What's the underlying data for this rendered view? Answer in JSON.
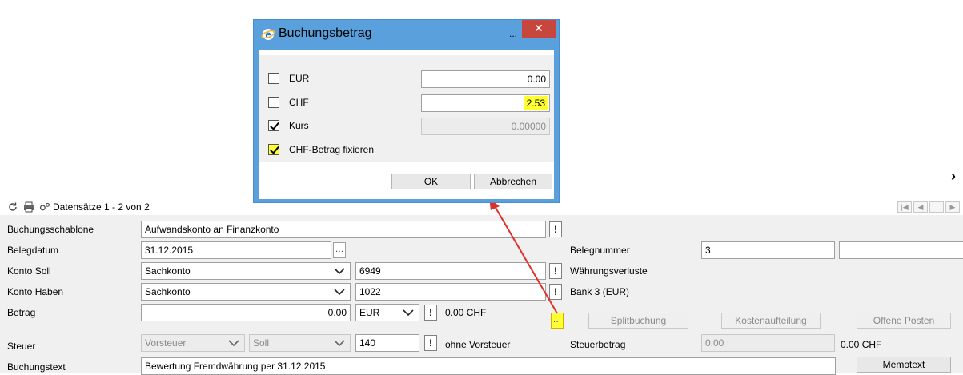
{
  "toolbar": {
    "records_label": "Datensätze 1 - 2 von 2",
    "nav_dots": "..."
  },
  "form": {
    "buchungsschablone": {
      "label": "Buchungsschablone",
      "label_underline": "g",
      "value": "Aufwandskonto an Finanzkonto"
    },
    "belegdatum": {
      "label": "Belegdatum",
      "value": "31.12.2015"
    },
    "belegnummer": {
      "label": "Belegnummer",
      "value": "3",
      "value2": ""
    },
    "konto_soll": {
      "label": "Konto Soll",
      "type": "Sachkonto",
      "value": "6949",
      "name": "Währungsverluste"
    },
    "konto_haben": {
      "label": "Konto Haben",
      "type": "Sachkonto",
      "value": "1022",
      "name": "Bank 3 (EUR)"
    },
    "betrag": {
      "label": "Betrag",
      "value": "0.00",
      "currency": "EUR",
      "converted": "0.00 CHF"
    },
    "steuer": {
      "label": "Steuer",
      "type": "Vorsteuer",
      "side": "Soll",
      "code": "140",
      "description": "ohne Vorsteuer",
      "steuerbetrag_label": "Steuerbetrag",
      "steuerbetrag_value": "0.00",
      "steuerbetrag_chf": "0.00 CHF"
    },
    "buchungstext": {
      "label": "Buchungstext",
      "value": "Bewertung Fremdwährung per 31.12.2015"
    },
    "buttons": {
      "splitbuchung": "Splitbuchung",
      "kostenaufteilung": "Kostenaufteilung",
      "offene_posten": "Offene Posten",
      "memotext": "Memotext"
    }
  },
  "dialog": {
    "title": "Buchungsbetrag",
    "title_dots": "...",
    "close": "✕",
    "rows": [
      {
        "label": "EUR",
        "checked": false,
        "value": "0.00"
      },
      {
        "label": "CHF",
        "checked": false,
        "value": "2.53"
      },
      {
        "label": "Kurs",
        "checked": true,
        "value": "0.00000"
      }
    ],
    "fix_label": "CHF-Betrag fixieren",
    "ok": "OK",
    "cancel": "Abbrechen"
  },
  "colors": {
    "highlight": "#ffff33",
    "dialog_frame": "#5aa0dc",
    "close": "#c7463d",
    "arrow": "#e0302a"
  }
}
